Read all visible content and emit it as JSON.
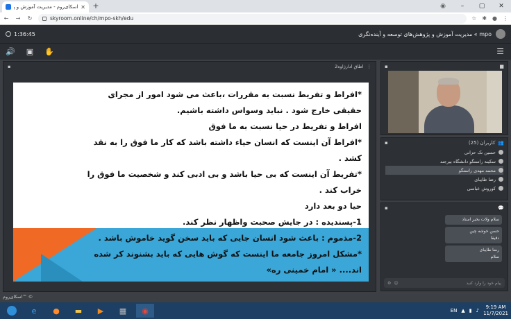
{
  "browser": {
    "tab_title": "اسکای‌روم - مدیریت آموزش و پژوه...",
    "url": "skyroom.online/ch/mpo-skh/edu",
    "window_controls": [
      "user-icon",
      "minimize",
      "maximize",
      "close"
    ]
  },
  "header": {
    "timer": "1:36:45",
    "room_title": "mpo » مدیریت آموزش و پژوهش‌های توسعه و آینده‌نگری"
  },
  "presentation": {
    "panel_title": "اطاق ادارژاوه2",
    "slide_lines": [
      "*افراط و تفریط نسبت به مقررات ،باعث می شود امور از مجرای",
      "حقیقی خارج شود . نباید وسواس داشته باشیم.",
      "افراط و تفریط در حیا نسبت به ما فوق",
      "*افراط آن اینست که انسان حیاء داشته باشد که کار ما فوق را به نقد",
      "کشد .",
      "*تفریط آن اینست که بی حیا باشد و بی ادبی کند و شخصیت ما فوق را",
      "خراب کند .",
      "حیا دو بعد دارد",
      "1-پسندیده : در جایش صحبت واظهار نظر کند.",
      "2-مذموم : باعث شود انسان جایی که باید سخن گوید خاموش باشد .",
      "*مشکل امروز جامعه ما اینست که گوش هایی که باید بشنوند کر شده",
      "اند.... « امام خمینی ره»"
    ]
  },
  "users": {
    "title": "کاربران (25)",
    "list": [
      {
        "name": "حسین تک حزانی",
        "active": false
      },
      {
        "name": "سکینه راستگو دانشگاه بیرجند",
        "active": false
      },
      {
        "name": "محمد مهدی راستگو",
        "active": true
      },
      {
        "name": "رضا طایبای",
        "active": false
      },
      {
        "name": "کوروش عباسی",
        "active": false
      }
    ]
  },
  "chat": {
    "messages": [
      {
        "lines": [
          "سلام ولات بخیر استاد"
        ]
      },
      {
        "lines": [
          "حسن خوشه چین",
          "دقیقا"
        ]
      },
      {
        "lines": [
          "رضا طایبای",
          "سلام"
        ]
      }
    ],
    "placeholder": "پیام خود را وارد کنید"
  },
  "footer_brand": "اسکای‌روم™ ©",
  "taskbar": {
    "lang": "EN",
    "time": "9:19 AM",
    "date": "11/7/2021"
  },
  "colors": {
    "slide_orange": "#f06a25",
    "slide_blue": "#3aa7d8",
    "app_bg": "#3c3f44",
    "taskbar": "#1c3f63"
  }
}
